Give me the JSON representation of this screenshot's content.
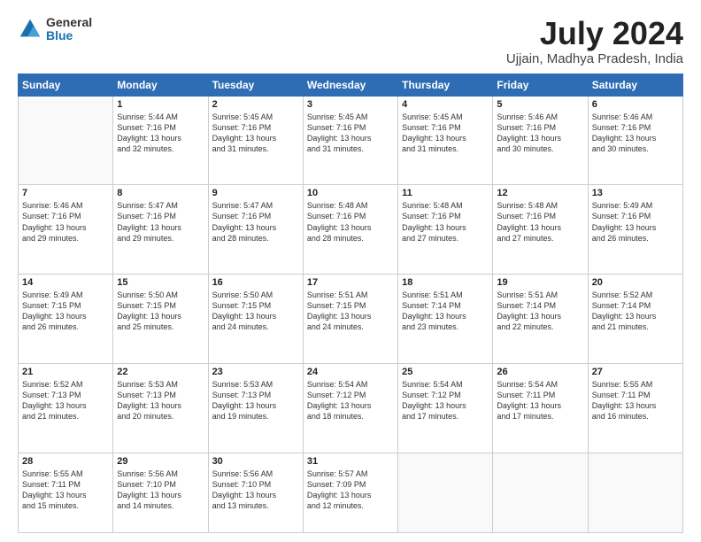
{
  "logo": {
    "general": "General",
    "blue": "Blue"
  },
  "title": {
    "month_year": "July 2024",
    "location": "Ujjain, Madhya Pradesh, India"
  },
  "days_of_week": [
    "Sunday",
    "Monday",
    "Tuesday",
    "Wednesday",
    "Thursday",
    "Friday",
    "Saturday"
  ],
  "weeks": [
    [
      {
        "day": "",
        "info": ""
      },
      {
        "day": "1",
        "info": "Sunrise: 5:44 AM\nSunset: 7:16 PM\nDaylight: 13 hours\nand 32 minutes."
      },
      {
        "day": "2",
        "info": "Sunrise: 5:45 AM\nSunset: 7:16 PM\nDaylight: 13 hours\nand 31 minutes."
      },
      {
        "day": "3",
        "info": "Sunrise: 5:45 AM\nSunset: 7:16 PM\nDaylight: 13 hours\nand 31 minutes."
      },
      {
        "day": "4",
        "info": "Sunrise: 5:45 AM\nSunset: 7:16 PM\nDaylight: 13 hours\nand 31 minutes."
      },
      {
        "day": "5",
        "info": "Sunrise: 5:46 AM\nSunset: 7:16 PM\nDaylight: 13 hours\nand 30 minutes."
      },
      {
        "day": "6",
        "info": "Sunrise: 5:46 AM\nSunset: 7:16 PM\nDaylight: 13 hours\nand 30 minutes."
      }
    ],
    [
      {
        "day": "7",
        "info": "Sunrise: 5:46 AM\nSunset: 7:16 PM\nDaylight: 13 hours\nand 29 minutes."
      },
      {
        "day": "8",
        "info": "Sunrise: 5:47 AM\nSunset: 7:16 PM\nDaylight: 13 hours\nand 29 minutes."
      },
      {
        "day": "9",
        "info": "Sunrise: 5:47 AM\nSunset: 7:16 PM\nDaylight: 13 hours\nand 28 minutes."
      },
      {
        "day": "10",
        "info": "Sunrise: 5:48 AM\nSunset: 7:16 PM\nDaylight: 13 hours\nand 28 minutes."
      },
      {
        "day": "11",
        "info": "Sunrise: 5:48 AM\nSunset: 7:16 PM\nDaylight: 13 hours\nand 27 minutes."
      },
      {
        "day": "12",
        "info": "Sunrise: 5:48 AM\nSunset: 7:16 PM\nDaylight: 13 hours\nand 27 minutes."
      },
      {
        "day": "13",
        "info": "Sunrise: 5:49 AM\nSunset: 7:16 PM\nDaylight: 13 hours\nand 26 minutes."
      }
    ],
    [
      {
        "day": "14",
        "info": "Sunrise: 5:49 AM\nSunset: 7:15 PM\nDaylight: 13 hours\nand 26 minutes."
      },
      {
        "day": "15",
        "info": "Sunrise: 5:50 AM\nSunset: 7:15 PM\nDaylight: 13 hours\nand 25 minutes."
      },
      {
        "day": "16",
        "info": "Sunrise: 5:50 AM\nSunset: 7:15 PM\nDaylight: 13 hours\nand 24 minutes."
      },
      {
        "day": "17",
        "info": "Sunrise: 5:51 AM\nSunset: 7:15 PM\nDaylight: 13 hours\nand 24 minutes."
      },
      {
        "day": "18",
        "info": "Sunrise: 5:51 AM\nSunset: 7:14 PM\nDaylight: 13 hours\nand 23 minutes."
      },
      {
        "day": "19",
        "info": "Sunrise: 5:51 AM\nSunset: 7:14 PM\nDaylight: 13 hours\nand 22 minutes."
      },
      {
        "day": "20",
        "info": "Sunrise: 5:52 AM\nSunset: 7:14 PM\nDaylight: 13 hours\nand 21 minutes."
      }
    ],
    [
      {
        "day": "21",
        "info": "Sunrise: 5:52 AM\nSunset: 7:13 PM\nDaylight: 13 hours\nand 21 minutes."
      },
      {
        "day": "22",
        "info": "Sunrise: 5:53 AM\nSunset: 7:13 PM\nDaylight: 13 hours\nand 20 minutes."
      },
      {
        "day": "23",
        "info": "Sunrise: 5:53 AM\nSunset: 7:13 PM\nDaylight: 13 hours\nand 19 minutes."
      },
      {
        "day": "24",
        "info": "Sunrise: 5:54 AM\nSunset: 7:12 PM\nDaylight: 13 hours\nand 18 minutes."
      },
      {
        "day": "25",
        "info": "Sunrise: 5:54 AM\nSunset: 7:12 PM\nDaylight: 13 hours\nand 17 minutes."
      },
      {
        "day": "26",
        "info": "Sunrise: 5:54 AM\nSunset: 7:11 PM\nDaylight: 13 hours\nand 17 minutes."
      },
      {
        "day": "27",
        "info": "Sunrise: 5:55 AM\nSunset: 7:11 PM\nDaylight: 13 hours\nand 16 minutes."
      }
    ],
    [
      {
        "day": "28",
        "info": "Sunrise: 5:55 AM\nSunset: 7:11 PM\nDaylight: 13 hours\nand 15 minutes."
      },
      {
        "day": "29",
        "info": "Sunrise: 5:56 AM\nSunset: 7:10 PM\nDaylight: 13 hours\nand 14 minutes."
      },
      {
        "day": "30",
        "info": "Sunrise: 5:56 AM\nSunset: 7:10 PM\nDaylight: 13 hours\nand 13 minutes."
      },
      {
        "day": "31",
        "info": "Sunrise: 5:57 AM\nSunset: 7:09 PM\nDaylight: 13 hours\nand 12 minutes."
      },
      {
        "day": "",
        "info": ""
      },
      {
        "day": "",
        "info": ""
      },
      {
        "day": "",
        "info": ""
      }
    ]
  ]
}
